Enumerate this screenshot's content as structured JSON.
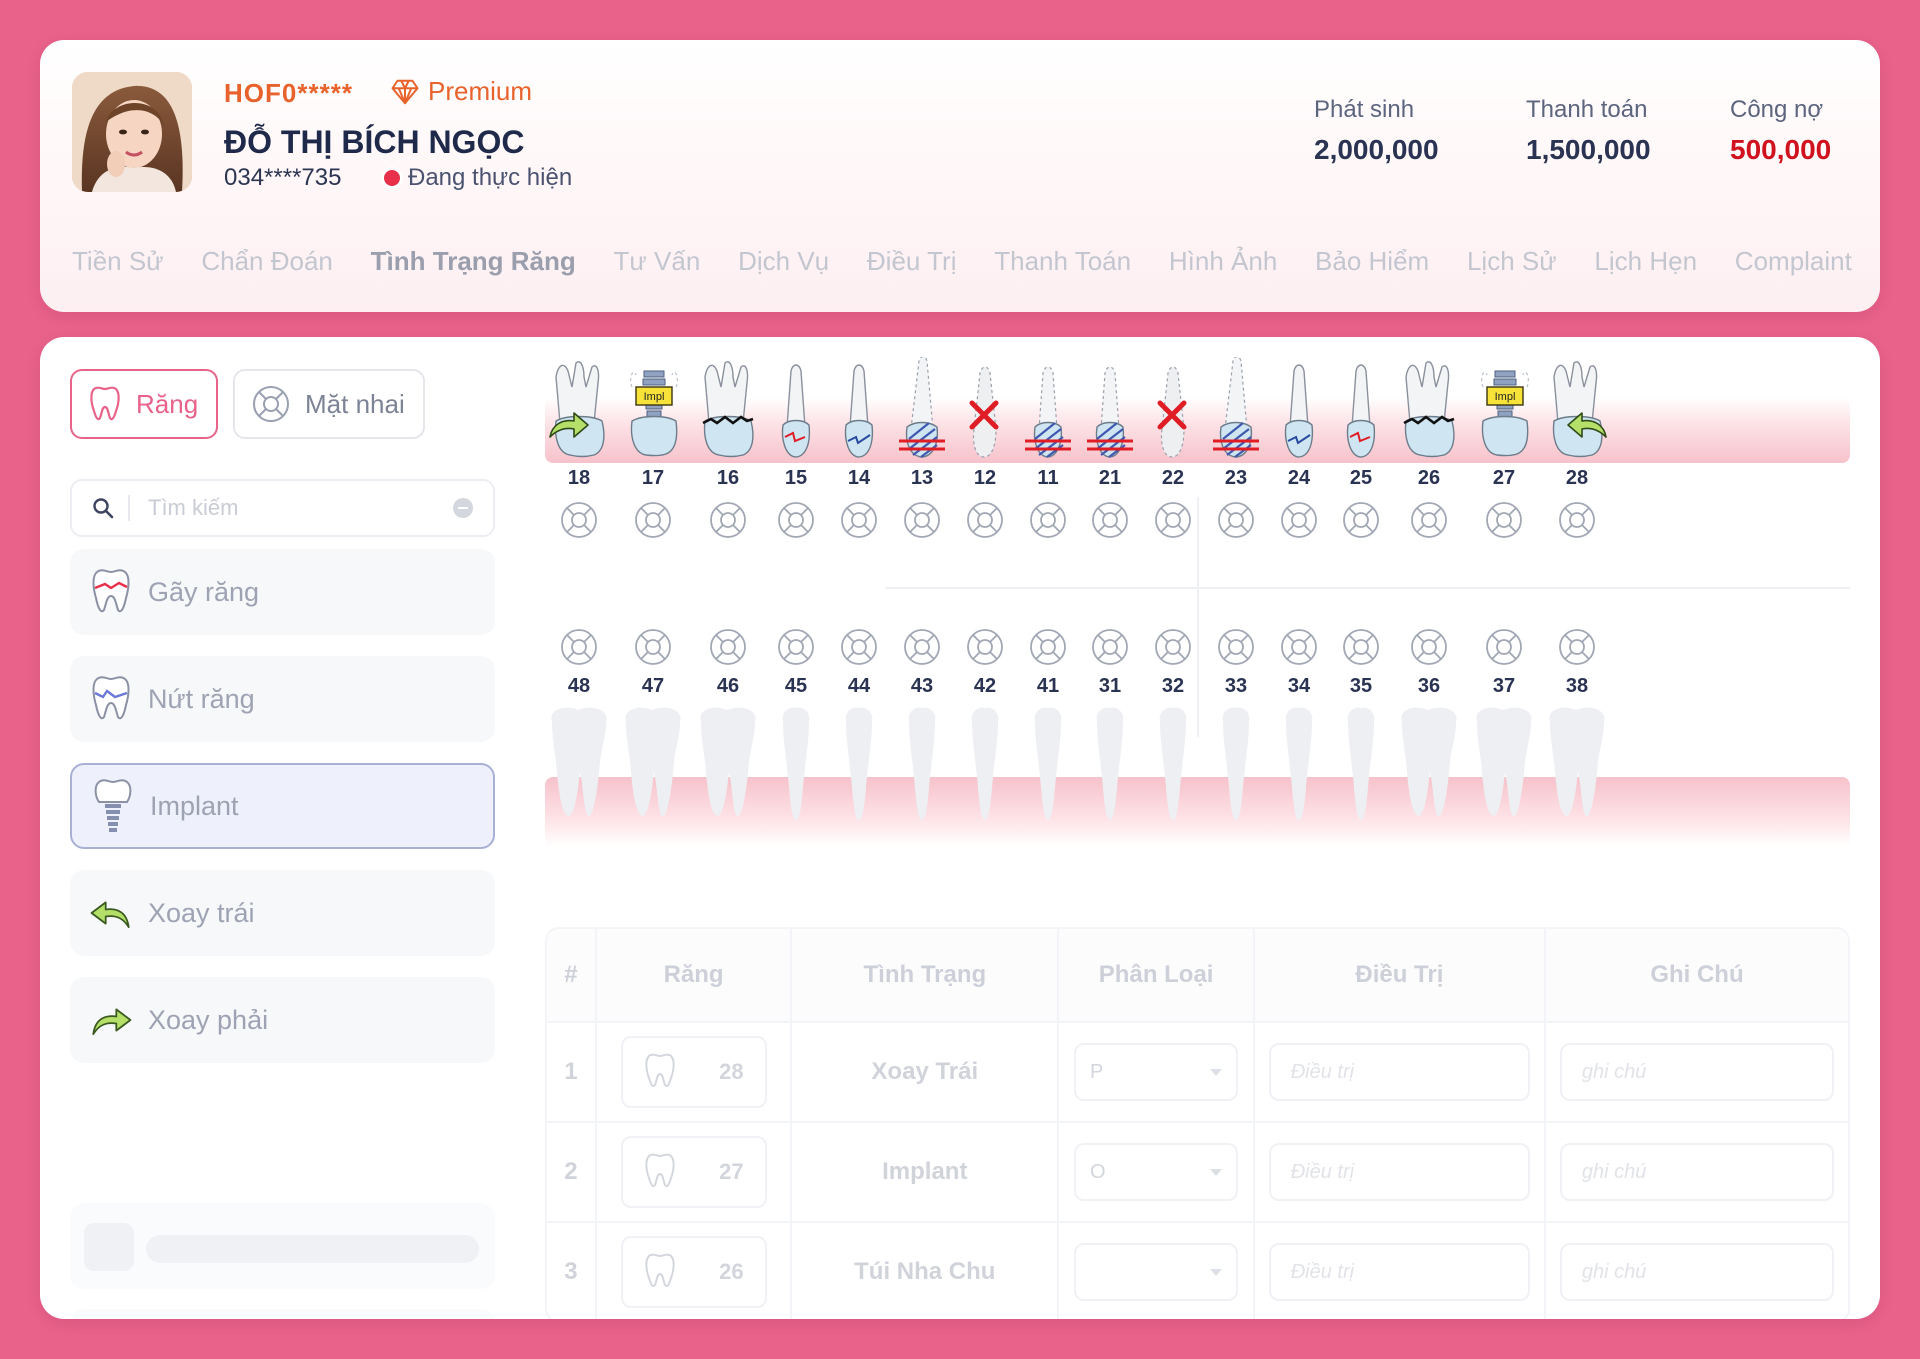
{
  "patient": {
    "id": "HOF0*****",
    "tier": "Premium",
    "name": "ĐỖ THỊ BÍCH NGỌC",
    "phone": "034****735",
    "status": "Đang thực hiện"
  },
  "stats": [
    {
      "label": "Phát sinh",
      "value": "2,000,000"
    },
    {
      "label": "Thanh toán",
      "value": "1,500,000"
    },
    {
      "label": "Công nợ",
      "value": "500,000"
    }
  ],
  "colors": {
    "accent": "#e8628a",
    "debt": "#d0121e",
    "orange": "#e8622c"
  },
  "tabs": [
    "Tiền Sử",
    "Chẩn Đoán",
    "Tình Trạng Răng",
    "Tư Vấn",
    "Dịch Vụ",
    "Điều Trị",
    "Thanh Toán",
    "Hình Ảnh",
    "Bảo Hiểm",
    "Lịch Sử",
    "Lịch Hẹn",
    "Complaint"
  ],
  "active_tab": "Tình Trạng Răng",
  "modes": {
    "teeth": "Răng",
    "occlusal": "Mặt nhai"
  },
  "search": {
    "placeholder": "Tìm kiếm"
  },
  "conditions": [
    {
      "label": "Gãy răng",
      "icon": "broken-tooth-icon"
    },
    {
      "label": "Nứt răng",
      "icon": "cracked-tooth-icon"
    },
    {
      "label": "Implant",
      "icon": "implant-icon",
      "selected": true
    },
    {
      "label": "Xoay trái",
      "icon": "rotate-left-icon"
    },
    {
      "label": "Xoay phải",
      "icon": "rotate-right-icon"
    }
  ],
  "upper_teeth": [
    {
      "num": "18",
      "kind": "molar",
      "mark": "rotate-right"
    },
    {
      "num": "17",
      "kind": "implant",
      "mark": "implant",
      "tag": "Impl"
    },
    {
      "num": "16",
      "kind": "molar",
      "mark": "pocket"
    },
    {
      "num": "15",
      "kind": "premolar",
      "mark": "fracture"
    },
    {
      "num": "14",
      "kind": "premolar",
      "mark": "crack"
    },
    {
      "num": "13",
      "kind": "canine",
      "mark": "hatched"
    },
    {
      "num": "12",
      "kind": "incisor",
      "mark": "missing"
    },
    {
      "num": "11",
      "kind": "incisor",
      "mark": "hatched"
    },
    {
      "num": "21",
      "kind": "incisor",
      "mark": "hatched"
    },
    {
      "num": "22",
      "kind": "incisor",
      "mark": "missing"
    },
    {
      "num": "23",
      "kind": "canine",
      "mark": "hatched"
    },
    {
      "num": "24",
      "kind": "premolar",
      "mark": "crack"
    },
    {
      "num": "25",
      "kind": "premolar",
      "mark": "fracture"
    },
    {
      "num": "26",
      "kind": "molar",
      "mark": "pocket"
    },
    {
      "num": "27",
      "kind": "implant",
      "mark": "implant",
      "tag": "Impl"
    },
    {
      "num": "28",
      "kind": "molar",
      "mark": "rotate-left"
    }
  ],
  "lower_teeth": [
    "48",
    "47",
    "46",
    "45",
    "44",
    "43",
    "42",
    "41",
    "31",
    "32",
    "33",
    "34",
    "35",
    "36",
    "37",
    "38"
  ],
  "table": {
    "headers": [
      "#",
      "Răng",
      "Tình Trạng",
      "Phân Loại",
      "Điều Trị",
      "Ghi Chú"
    ],
    "rows": [
      {
        "idx": "1",
        "tooth": "28",
        "condition": "Xoay Trái",
        "type": "P",
        "treatment": "Điều trị",
        "note": "ghi chú"
      },
      {
        "idx": "2",
        "tooth": "27",
        "condition": "Implant",
        "type": "O",
        "treatment": "Điều trị",
        "note": "ghi chú"
      },
      {
        "idx": "3",
        "tooth": "26",
        "condition": "Túi Nha Chu",
        "type": "",
        "treatment": "Điều trị",
        "note": "ghi chú"
      }
    ]
  }
}
